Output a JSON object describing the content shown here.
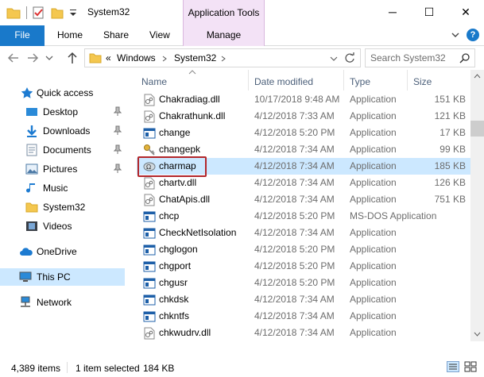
{
  "window": {
    "title": "System32",
    "context_tab_header": "Application Tools",
    "minimize": "─",
    "maximize": "☐",
    "close": "✕"
  },
  "ribbon": {
    "file": "File",
    "home": "Home",
    "share": "Share",
    "view": "View",
    "manage": "Manage",
    "help": "?"
  },
  "address": {
    "prefix": "«",
    "segments": [
      "Windows",
      "System32"
    ],
    "search_placeholder": "Search System32"
  },
  "nav": {
    "items": [
      {
        "label": "Quick access",
        "icon": "star-icon"
      },
      {
        "label": "Desktop",
        "icon": "desktop-icon"
      },
      {
        "label": "Downloads",
        "icon": "download-icon"
      },
      {
        "label": "Documents",
        "icon": "documents-icon"
      },
      {
        "label": "Pictures",
        "icon": "pictures-icon"
      },
      {
        "label": "Music",
        "icon": "music-icon"
      },
      {
        "label": "System32",
        "icon": "folder-icon"
      },
      {
        "label": "Videos",
        "icon": "videos-icon"
      },
      {
        "label": "OneDrive",
        "icon": "cloud-icon"
      },
      {
        "label": "This PC",
        "icon": "computer-icon"
      },
      {
        "label": "Network",
        "icon": "network-icon"
      }
    ]
  },
  "columns": {
    "name": "Name",
    "date": "Date modified",
    "type": "Type",
    "size": "Size"
  },
  "files": [
    {
      "name": "Chakradiag.dll",
      "date": "10/17/2018 9:48 AM",
      "type": "Application",
      "size": "151 KB",
      "icon": "dll-icon"
    },
    {
      "name": "Chakrathunk.dll",
      "date": "4/12/2018 7:33 AM",
      "type": "Application",
      "size": "121 KB",
      "icon": "dll-icon"
    },
    {
      "name": "change",
      "date": "4/12/2018 5:20 PM",
      "type": "Application",
      "size": "17 KB",
      "icon": "exe-icon"
    },
    {
      "name": "changepk",
      "date": "4/12/2018 7:34 AM",
      "type": "Application",
      "size": "99 KB",
      "icon": "key-icon"
    },
    {
      "name": "charmap",
      "date": "4/12/2018 7:34 AM",
      "type": "Application",
      "size": "185 KB",
      "icon": "charmap-icon"
    },
    {
      "name": "chartv.dll",
      "date": "4/12/2018 7:34 AM",
      "type": "Application",
      "size": "126 KB",
      "icon": "dll-icon"
    },
    {
      "name": "ChatApis.dll",
      "date": "4/12/2018 7:34 AM",
      "type": "Application",
      "size": "751 KB",
      "icon": "dll-icon"
    },
    {
      "name": "chcp",
      "date": "4/12/2018 5:20 PM",
      "type": "MS-DOS Application",
      "size": "",
      "icon": "exe-icon"
    },
    {
      "name": "CheckNetIsolation",
      "date": "4/12/2018 7:34 AM",
      "type": "Application",
      "size": "",
      "icon": "exe-icon"
    },
    {
      "name": "chglogon",
      "date": "4/12/2018 5:20 PM",
      "type": "Application",
      "size": "",
      "icon": "exe-icon"
    },
    {
      "name": "chgport",
      "date": "4/12/2018 5:20 PM",
      "type": "Application",
      "size": "",
      "icon": "exe-icon"
    },
    {
      "name": "chgusr",
      "date": "4/12/2018 5:20 PM",
      "type": "Application",
      "size": "",
      "icon": "exe-icon"
    },
    {
      "name": "chkdsk",
      "date": "4/12/2018 7:34 AM",
      "type": "Application",
      "size": "",
      "icon": "exe-icon"
    },
    {
      "name": "chkntfs",
      "date": "4/12/2018 7:34 AM",
      "type": "Application",
      "size": "",
      "icon": "exe-icon"
    },
    {
      "name": "chkwudrv.dll",
      "date": "4/12/2018 7:34 AM",
      "type": "Application",
      "size": "",
      "icon": "dll-icon"
    }
  ],
  "status": {
    "item_count": "4,389 items",
    "selection": "1 item selected",
    "selection_size": "184 KB"
  },
  "colors": {
    "accent": "#1979ca",
    "selection": "#cce8ff",
    "context_tab": "#f3e2f6",
    "highlight_border": "#b3262a"
  }
}
